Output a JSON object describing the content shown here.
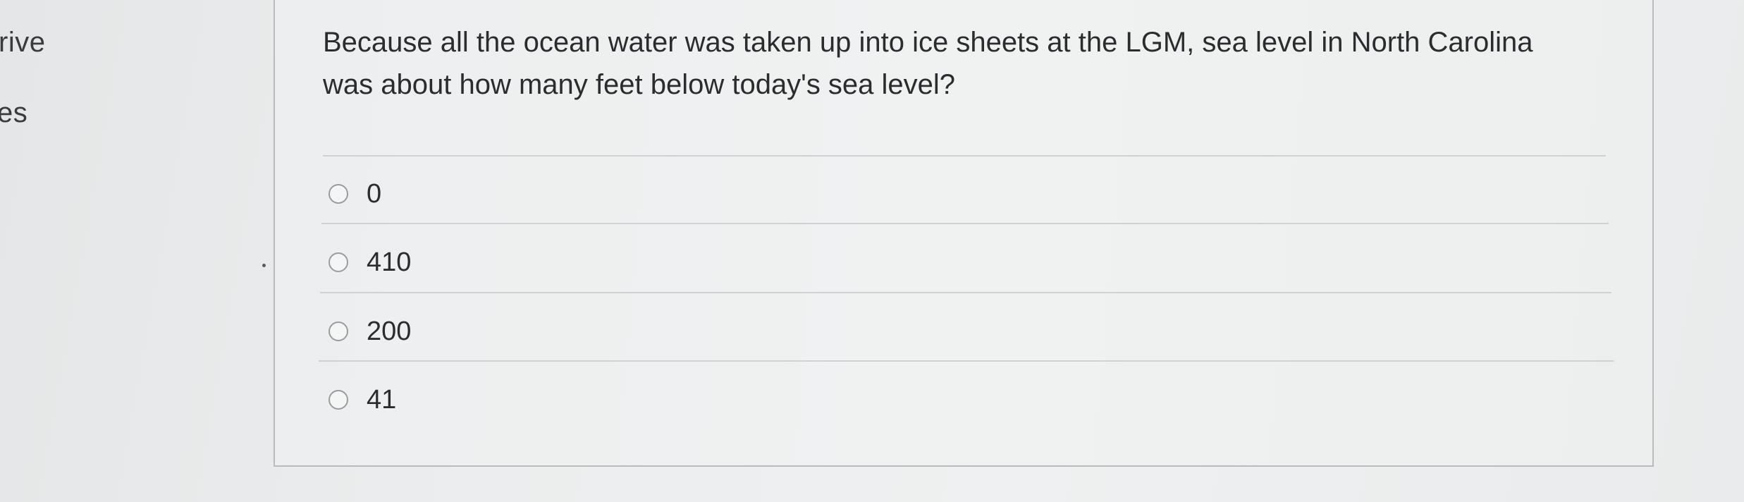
{
  "sidebar": {
    "items": [
      {
        "label": "rive"
      },
      {
        "label": "es"
      }
    ]
  },
  "question": {
    "text": "Because all the ocean water was taken up into ice sheets at the LGM, sea level in North Carolina was about how many feet below today's sea level?"
  },
  "answers": [
    {
      "label": "0"
    },
    {
      "label": "410"
    },
    {
      "label": "200"
    },
    {
      "label": "41"
    }
  ]
}
